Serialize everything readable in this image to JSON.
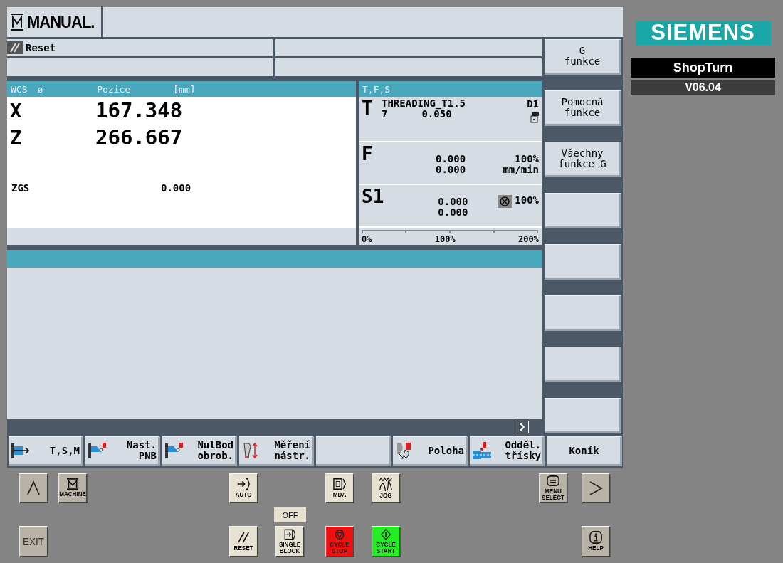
{
  "mode": {
    "label": "MANUAL."
  },
  "status": {
    "reset": "Reset"
  },
  "position": {
    "header": {
      "system": "WCS",
      "diameter": "ø",
      "title": "Pozice",
      "unit": "[mm]"
    },
    "axes": [
      {
        "name": "X",
        "value": "167.348"
      },
      {
        "name": "Z",
        "value": "266.667"
      }
    ],
    "extra": {
      "name": "ZGS",
      "value": "0.000"
    }
  },
  "tfs": {
    "title": "T,F,S",
    "tool": {
      "letter": "T",
      "name": "THREADING_T1.5",
      "number": "7",
      "value": "0.050",
      "edge": "D1"
    },
    "feed": {
      "letter": "F",
      "value1": "0.000",
      "value2": "0.000",
      "override": "100%",
      "unit": "mm/min"
    },
    "spindle": {
      "letter": "S1",
      "value1": "0.000",
      "value2": "0.000",
      "override": "100%"
    },
    "scale": [
      "0%",
      "100%",
      "200%"
    ]
  },
  "vertical_softkeys": [
    {
      "kind": "label",
      "lines": [
        "G",
        "funkce"
      ]
    },
    {
      "kind": "label",
      "lines": [
        "Pomocná",
        "funkce"
      ]
    },
    {
      "kind": "label",
      "lines": [
        "Všechny",
        "funkce G"
      ]
    },
    {
      "kind": "blank"
    },
    {
      "kind": "blank"
    },
    {
      "kind": "blank"
    },
    {
      "kind": "blank"
    },
    {
      "kind": "blank"
    }
  ],
  "horizontal_softkeys": [
    {
      "kind": "tsm",
      "lines": [
        "T,S,M"
      ]
    },
    {
      "kind": "pnb",
      "lines": [
        "Nast.",
        "PNB"
      ]
    },
    {
      "kind": "nulbod",
      "lines": [
        "NulBod",
        "obrob."
      ]
    },
    {
      "kind": "mereni",
      "lines": [
        "Měření",
        "nástr."
      ]
    },
    {
      "kind": "blank"
    },
    {
      "kind": "poloha",
      "lines": [
        "Poloha"
      ]
    },
    {
      "kind": "oddel",
      "lines": [
        "Odděl.",
        "třísky"
      ]
    },
    {
      "kind": "text",
      "lines": [
        "Koník"
      ]
    }
  ],
  "branding": {
    "logo": "SIEMENS",
    "product": "ShopTurn",
    "version": "V06.04"
  },
  "panel_buttons": [
    {
      "kind": "up"
    },
    {
      "kind": "machine",
      "label": "MACHINE"
    },
    {
      "kind": "auto",
      "label": "AUTO"
    },
    {
      "kind": "mda",
      "label": "MDA"
    },
    {
      "kind": "jog",
      "label": "JOG"
    },
    {
      "kind": "menu",
      "lines": [
        "MENU",
        "SELECT"
      ]
    },
    {
      "kind": "next"
    },
    {
      "kind": "exit",
      "label": "EXIT"
    },
    {
      "kind": "reset",
      "label": "RESET"
    },
    {
      "kind": "single",
      "lines": [
        "SINGLE",
        "BLOCK"
      ],
      "indicator": "OFF"
    },
    {
      "kind": "stop",
      "lines": [
        "CYCLE",
        "STOP"
      ]
    },
    {
      "kind": "start",
      "lines": [
        "CYCLE",
        "START"
      ]
    },
    {
      "kind": "help",
      "label": "HELP"
    }
  ]
}
